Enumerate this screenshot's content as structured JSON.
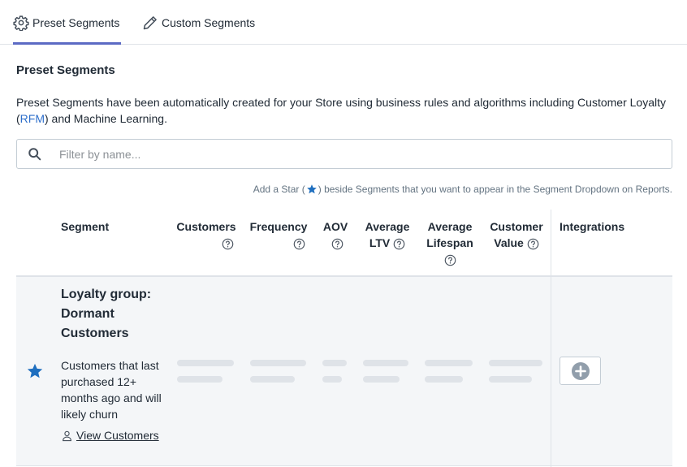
{
  "tabs": [
    {
      "label": "Preset Segments",
      "icon": "gear-icon",
      "active": true
    },
    {
      "label": "Custom Segments",
      "icon": "pencil-icon",
      "active": false
    }
  ],
  "section": {
    "title": "Preset Segments",
    "desc_before": "Preset Segments have been automatically created for your Store using business rules and algorithms including Customer Loyalty (",
    "desc_link": "RFM",
    "desc_after": ") and Machine Learning."
  },
  "search": {
    "placeholder": "Filter by name...",
    "value": ""
  },
  "hint": {
    "before": "Add a Star (",
    "after": ") beside Segments that you want to appear in the Segment Dropdown on Reports."
  },
  "table": {
    "headers": {
      "segment": "Segment",
      "customers": "Customers",
      "frequency": "Frequency",
      "aov": "AOV",
      "ltv_1": "Average",
      "ltv_2": "LTV",
      "lifespan_1": "Average",
      "lifespan_2": "Lifespan",
      "value_1": "Customer",
      "value_2": "Value",
      "integrations": "Integrations"
    },
    "rows": [
      {
        "name": "Loyalty group: Dormant Customers",
        "description": "Customers that last purchased 12+ months ago and will likely churn",
        "link": "View Customers",
        "starred": true
      }
    ]
  },
  "colors": {
    "accent": "#5c6ac4",
    "link": "#2c6ecb",
    "star": "#1f6fbf",
    "skeleton": "#dfe3e8",
    "row_bg": "#f4f6f8"
  }
}
